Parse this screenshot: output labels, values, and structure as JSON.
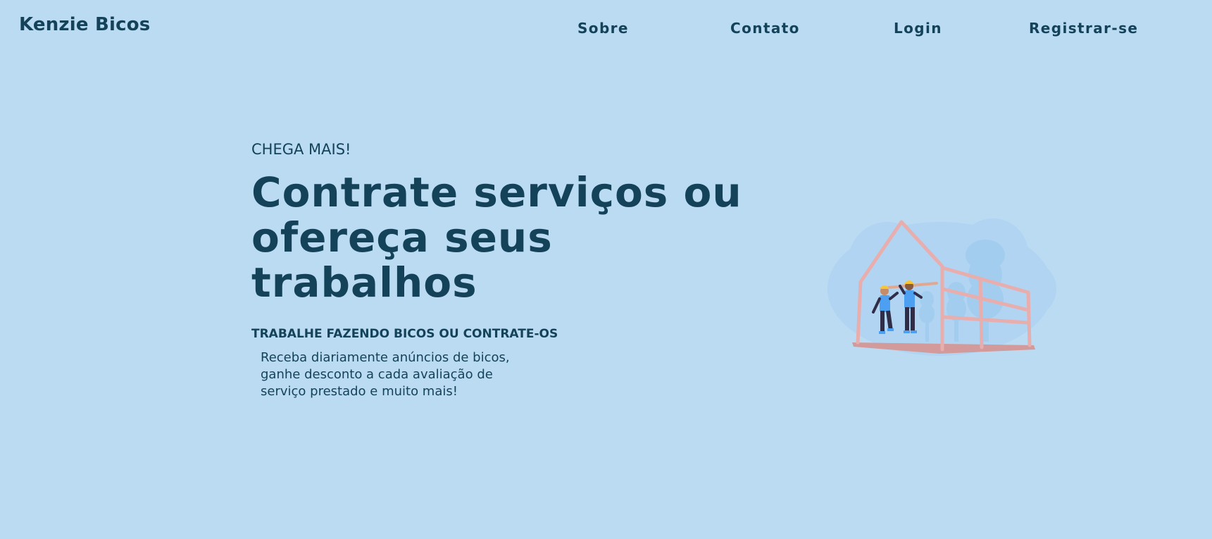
{
  "header": {
    "brand": "Kenzie Bicos",
    "nav": {
      "sobre": "Sobre",
      "contato": "Contato",
      "login": "Login",
      "registrar": "Registrar-se"
    }
  },
  "hero": {
    "eyebrow": "CHEGA MAIS!",
    "headline": "Contrate serviços ou ofereça seus trabalhos",
    "subheadline": "TRABALHE FAZENDO BICOS OU CONTRATE-OS",
    "description": "Receba diariamente anúncios de bicos, ganhe desconto a cada avaliação de serviço prestado e muito mais!"
  },
  "colors": {
    "background": "#bbdbf3",
    "text": "#144359",
    "frame": "#e8aeae",
    "tree": "#a3cdef",
    "worker_shirt": "#4d9ff2",
    "worker_pants": "#2f2d48",
    "helmet": "#f7c632"
  },
  "icons": {
    "illustration": "workers-building-house-illustration"
  }
}
